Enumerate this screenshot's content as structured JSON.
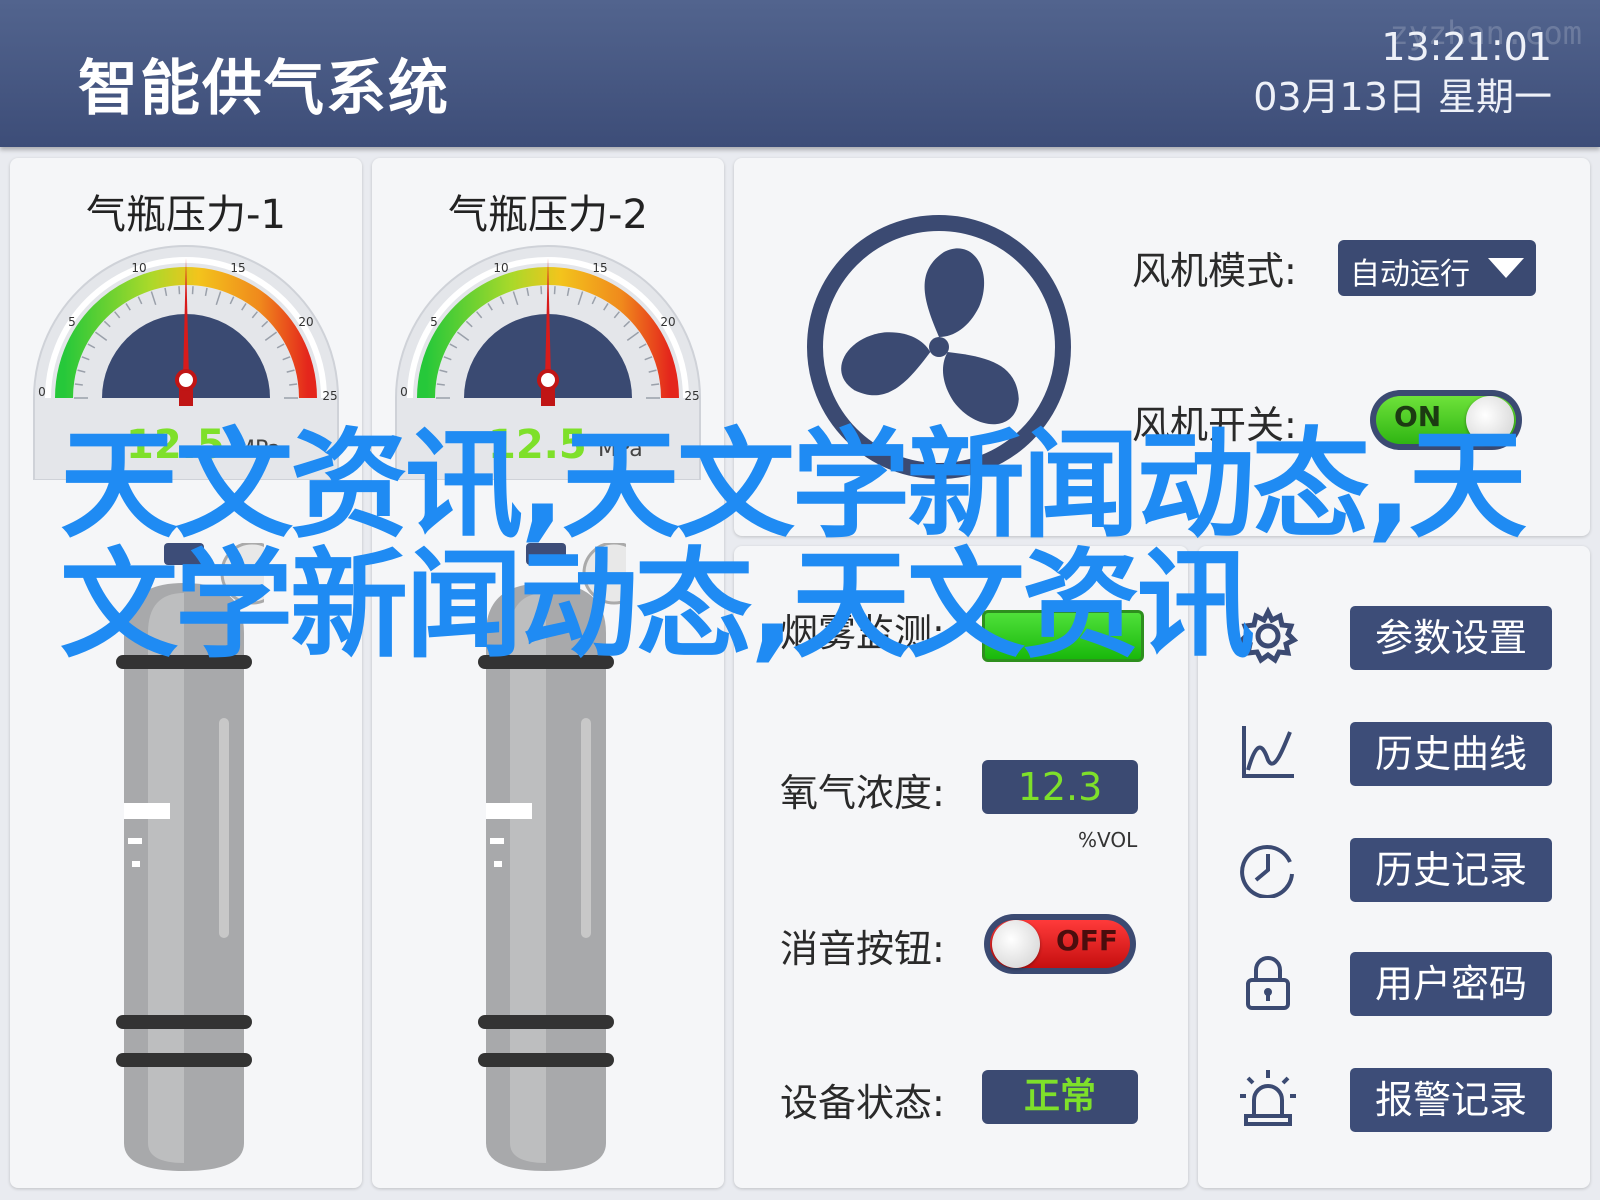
{
  "header": {
    "title": "智能供气系统",
    "time": "13:21:01",
    "date": "03月13日  星期一",
    "watermark": "zyzhan.com"
  },
  "gauges": [
    {
      "title": "气瓶压力-1",
      "value_text": "12.5",
      "unit": "MPa",
      "value": 12.5,
      "scale_min": 0,
      "scale_max": 25,
      "ticks": [
        "0",
        "5",
        "10",
        "15",
        "20",
        "25"
      ]
    },
    {
      "title": "气瓶压力-2",
      "value_text": "12.5",
      "unit": "MPa",
      "value": 12.5,
      "scale_min": 0,
      "scale_max": 25,
      "ticks": [
        "0",
        "5",
        "10",
        "15",
        "20",
        "25"
      ]
    }
  ],
  "fan": {
    "mode_label": "风机模式:",
    "mode_value": "自动运行",
    "switch_label": "风机开关:",
    "switch_state": "ON"
  },
  "monitor": {
    "smoke_label": "烟雾监测:",
    "oxygen_label": "氧气浓度:",
    "oxygen_value": "12.3",
    "oxygen_unit": "%VOL",
    "mute_label": "消音按钮:",
    "mute_state": "OFF",
    "status_label": "设备状态:",
    "status_value": "正常"
  },
  "menu": {
    "items": [
      {
        "label": "参数设置",
        "icon": "gear-icon"
      },
      {
        "label": "历史曲线",
        "icon": "line-chart-icon"
      },
      {
        "label": "历史记录",
        "icon": "clock-icon"
      },
      {
        "label": "用户密码",
        "icon": "lock-icon"
      },
      {
        "label": "报警记录",
        "icon": "alarm-light-icon"
      }
    ]
  },
  "overlay": {
    "text": "天文资讯,天文学新闻动态,天文学新闻动态,天文资讯"
  },
  "colors": {
    "header": "#3d4d78",
    "accent_dark": "#3b4a72",
    "on_green": "#3ccf1a",
    "off_red": "#e21b1b",
    "value_green": "#7ee02a",
    "overlay_blue": "#1f8bf3",
    "needle_red": "#d81b1b"
  }
}
